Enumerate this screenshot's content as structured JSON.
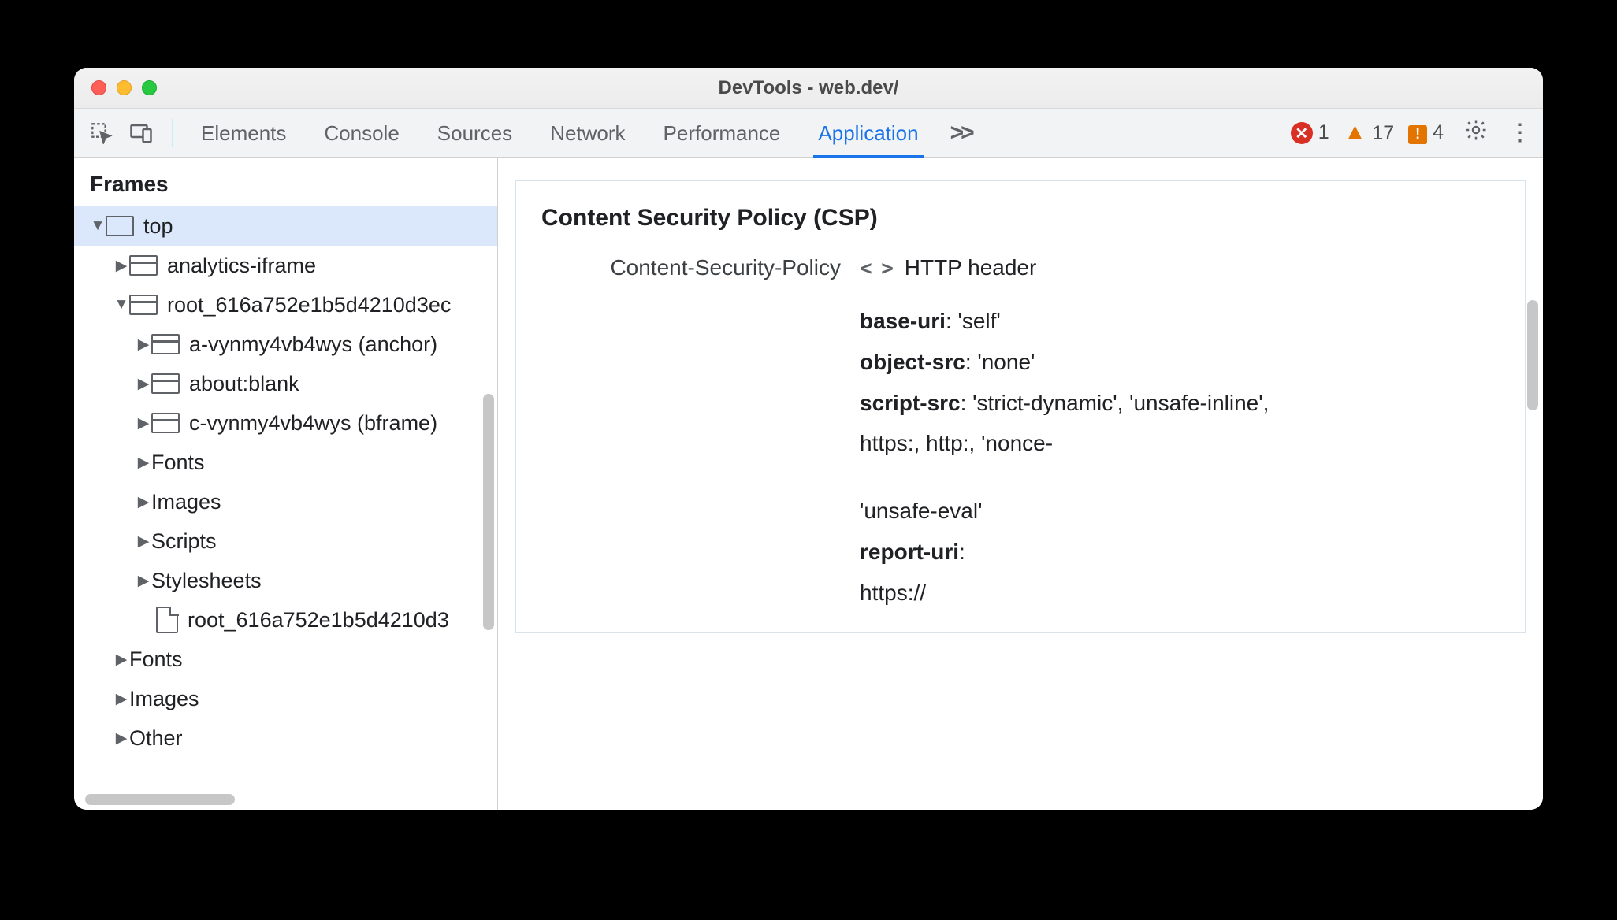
{
  "window": {
    "title": "DevTools - web.dev/"
  },
  "tabs": {
    "elements": "Elements",
    "console": "Console",
    "sources": "Sources",
    "network": "Network",
    "performance": "Performance",
    "application": "Application"
  },
  "counters": {
    "errors": "1",
    "warnings": "17",
    "issues": "4"
  },
  "sidebar": {
    "section": "Frames",
    "rows": [
      {
        "label": "top"
      },
      {
        "label": "analytics-iframe"
      },
      {
        "label": "root_616a752e1b5d4210d3ec"
      },
      {
        "label": "a-vynmy4vb4wys (anchor)"
      },
      {
        "label": "about:blank"
      },
      {
        "label": "c-vynmy4vb4wys (bframe)"
      },
      {
        "label": "Fonts"
      },
      {
        "label": "Images"
      },
      {
        "label": "Scripts"
      },
      {
        "label": "Stylesheets"
      },
      {
        "label": "root_616a752e1b5d4210d3"
      },
      {
        "label": "Fonts"
      },
      {
        "label": "Images"
      },
      {
        "label": "Other"
      }
    ]
  },
  "csp": {
    "heading": "Content Security Policy (CSP)",
    "rowLabel": "Content-Security-Policy",
    "source": "HTTP header",
    "d1k": "base-uri",
    "d1v": ": 'self'",
    "d2k": "object-src",
    "d2v": ": 'none'",
    "d3k": "script-src",
    "d3v": ": 'strict-dynamic', 'unsafe-inline',",
    "d4": "https:, http:, 'nonce-",
    "d5": "'unsafe-eval'",
    "d6k": "report-uri",
    "d6v": ":",
    "d7": "https://"
  }
}
